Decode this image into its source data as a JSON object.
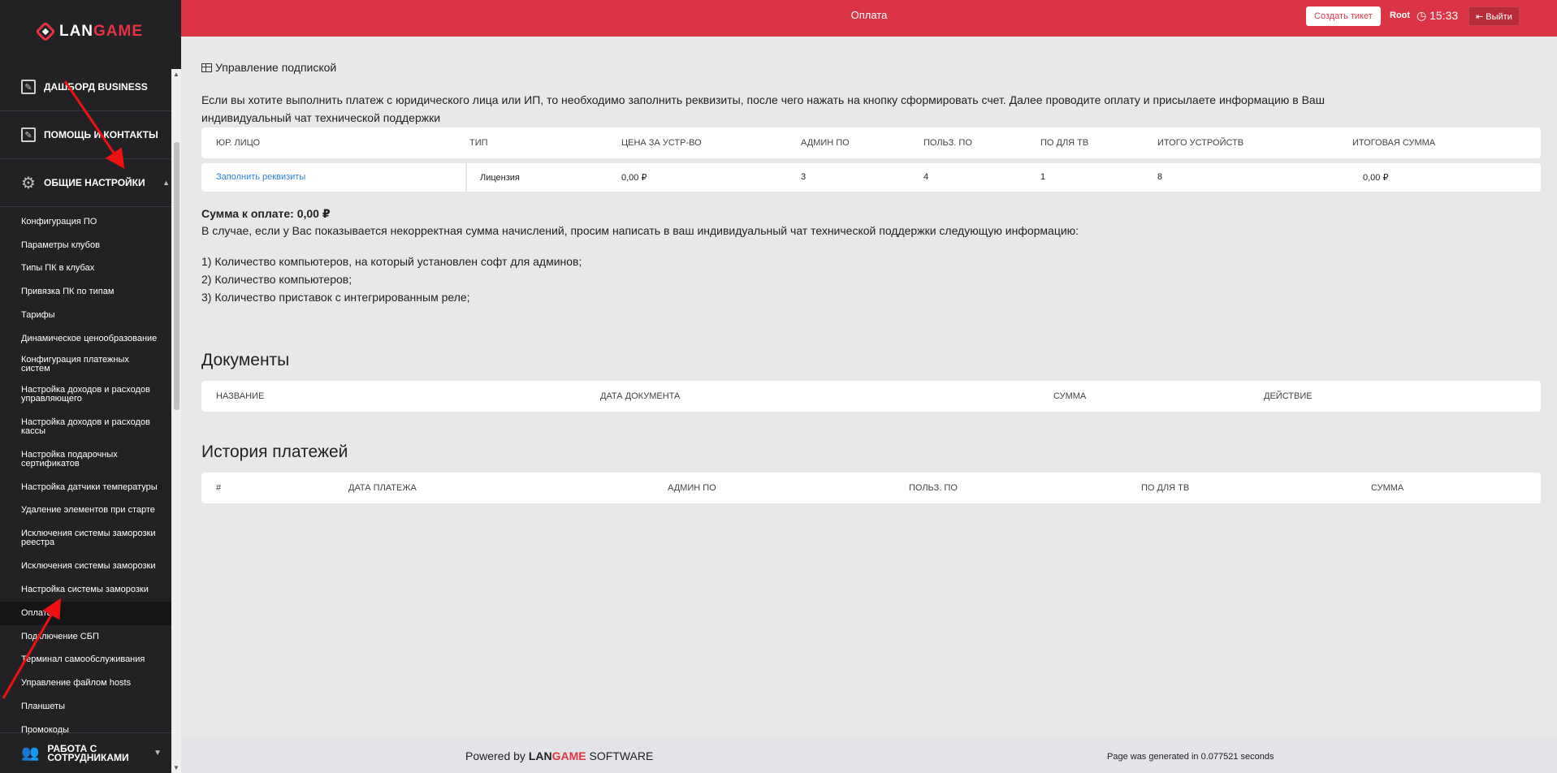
{
  "sidebar": {
    "logo": {
      "part1": "LAN",
      "part2": "GAME"
    },
    "sections": [
      {
        "label": "ДАШБОРД BUSINESS"
      },
      {
        "label": "ПОМОЩЬ И КОНТАКТЫ"
      },
      {
        "label": "ОБЩИЕ НАСТРОЙКИ"
      }
    ],
    "items": [
      "Конфигурация ПО",
      "Параметры клубов",
      "Типы ПК в клубах",
      "Привязка ПК по типам",
      "Тарифы",
      "Динамическое ценообразование",
      "Конфигурация платежных систем",
      "Настройка доходов и расходов управляющего",
      "Настройка доходов и расходов кассы",
      "Настройка подарочных сертификатов",
      "Настройка датчики температуры",
      "Удаление элементов при старте",
      "Исключения системы заморозки реестра",
      "Исключения системы заморозки",
      "Настройка системы заморозки",
      "Оплата",
      "Подключение СБП",
      "Терминал самообслуживания",
      "Управление файлом hosts",
      "Планшеты",
      "Промокоды"
    ],
    "active_item": "Оплата",
    "bottom_section": "РАБОТА С СОТРУДНИКАМИ"
  },
  "header": {
    "title": "Оплата",
    "ticket_button": "Создать тикет",
    "user": "Root",
    "time": "15:33",
    "logout": "Выйти"
  },
  "subscription": {
    "title": "Управление подпиской",
    "intro": "Если вы хотите выполнить платеж с юридического лица или ИП, то необходимо заполнить реквизиты, после чего нажать на кнопку сформировать счет. Далее проводите оплату и присылаете информацию в Ваш индивидуальный чат технической поддержки",
    "columns": [
      "ЮР. ЛИЦО",
      "ТИП",
      "ЦЕНА ЗА УСТР-ВО",
      "АДМИН ПО",
      "ПОЛЬЗ. ПО",
      "ПО ДЛЯ ТВ",
      "ИТОГО УСТРОЙСТВ",
      "ИТОГОВАЯ СУММА"
    ],
    "row": {
      "entity_link": "Заполнить реквизиты",
      "type": "Лицензия",
      "price": "0,00 ₽",
      "admin": "3",
      "user": "4",
      "tv": "1",
      "total_devices": "8",
      "total_sum": "0,00 ₽"
    },
    "sum_label": "Сумма к оплате: 0,00 ₽",
    "note": "В случае, если у Вас показывается некорректная сумма начислений, просим написать в ваш индивидуальный чат технической поддержки следующую информацию:",
    "list": [
      "1) Количество компьютеров, на который установлен софт для админов;",
      "2) Количество компьютеров;",
      "3) Количество приставок с интегрированным реле;"
    ]
  },
  "documents": {
    "title": "Документы",
    "columns": [
      "НАЗВАНИЕ",
      "ДАТА ДОКУМЕНТА",
      "СУММА",
      "ДЕЙСТВИЕ"
    ]
  },
  "payments": {
    "title": "История платежей",
    "columns": [
      "#",
      "ДАТА ПЛАТЕЖА",
      "АДМИН ПО",
      "ПОЛЬЗ. ПО",
      "ПО ДЛЯ ТВ",
      "СУММА"
    ]
  },
  "footer": {
    "powered_prefix": "Powered by",
    "brand1": "LAN",
    "brand2": "GAME",
    "suffix": "SOFTWARE",
    "generated": "Page was generated in 0.077521 seconds"
  },
  "colors": {
    "accent": "#db3545",
    "sidebar": "#222225",
    "link": "#2f7fd8"
  }
}
